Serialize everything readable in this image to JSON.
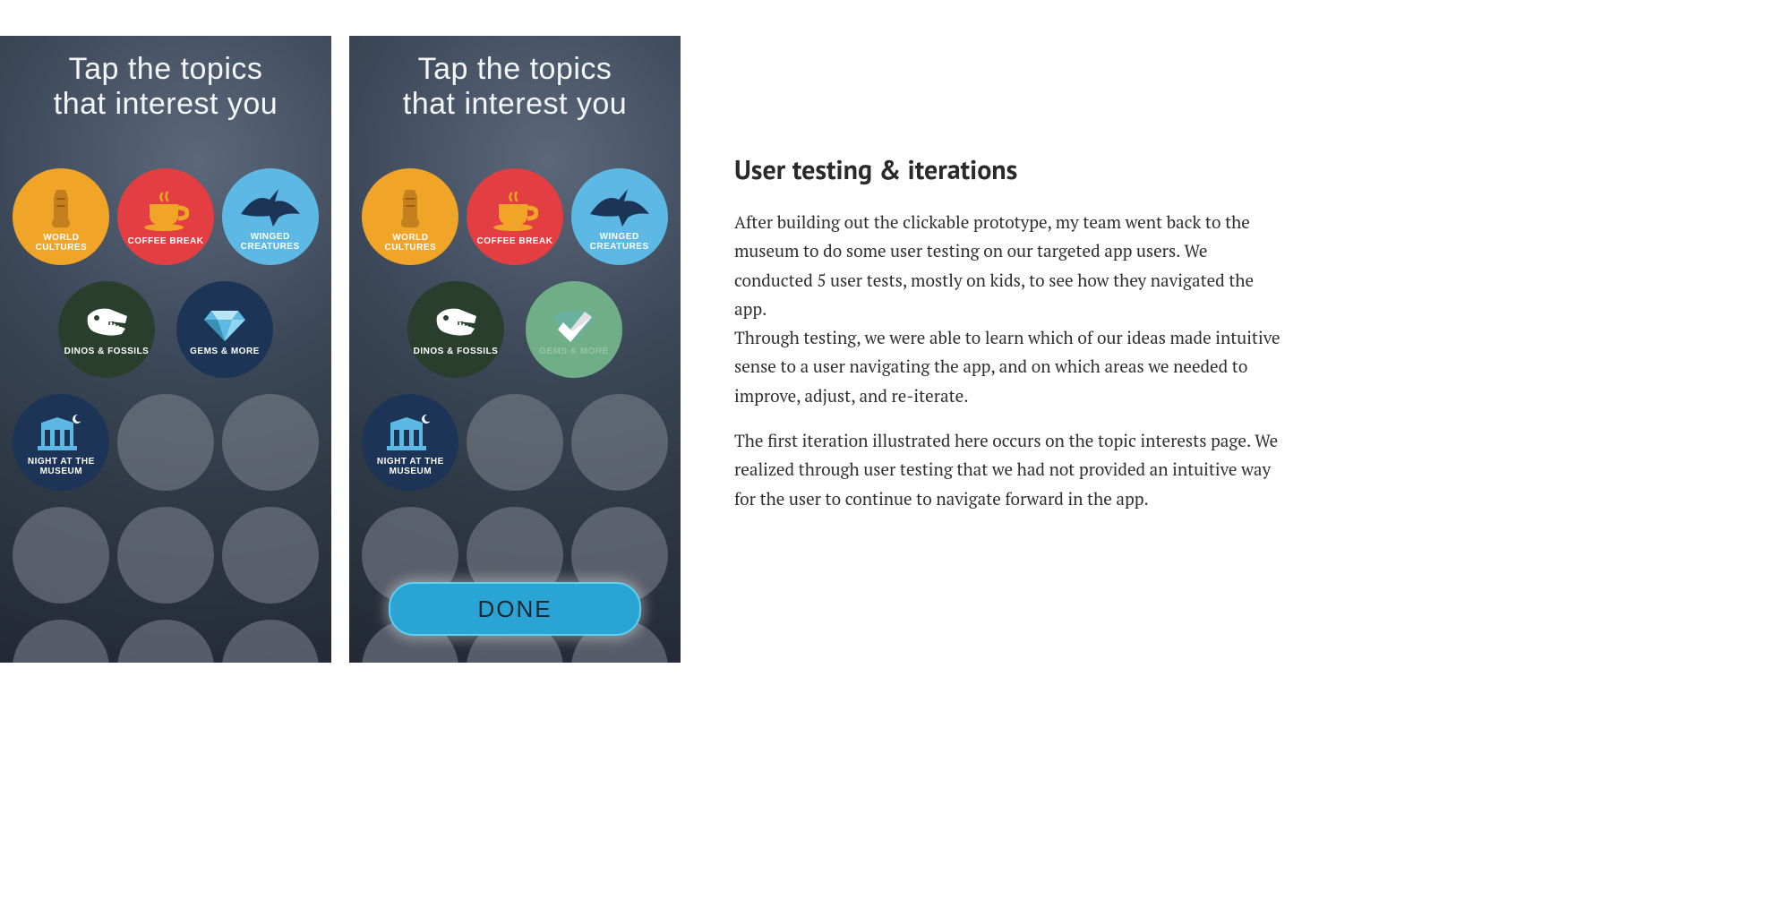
{
  "phoneTitle": {
    "line1": "Tap the topics",
    "line2": "that interest you"
  },
  "topics": {
    "worldCultures": "WORLD CULTURES",
    "coffeeBreak": "COFFEE BREAK",
    "wingedCreatures": "WINGED CREATURES",
    "dinosFossils": "DINOS & FOSSILS",
    "gemsMore": "GEMS & MORE",
    "nightMuseum": "NIGHT AT THE MUSEUM"
  },
  "doneLabel": "DONE",
  "article": {
    "heading": "User testing & iterations",
    "p1": "After building out the clickable prototype, my team went back to the museum to do some user testing on our targeted app users. We conducted 5 user tests, mostly on kids, to see how they navigated the app.",
    "p2": "Through testing, we were able to learn which of our ideas made intuitive sense to a user navigating the app, and on which areas we needed to improve, adjust, and re-iterate.",
    "p3": "The first iteration illustrated here occurs on the topic interests page. We realized through user testing that we had not provided an intuitive way for the user to continue to navigate forward in the app."
  }
}
